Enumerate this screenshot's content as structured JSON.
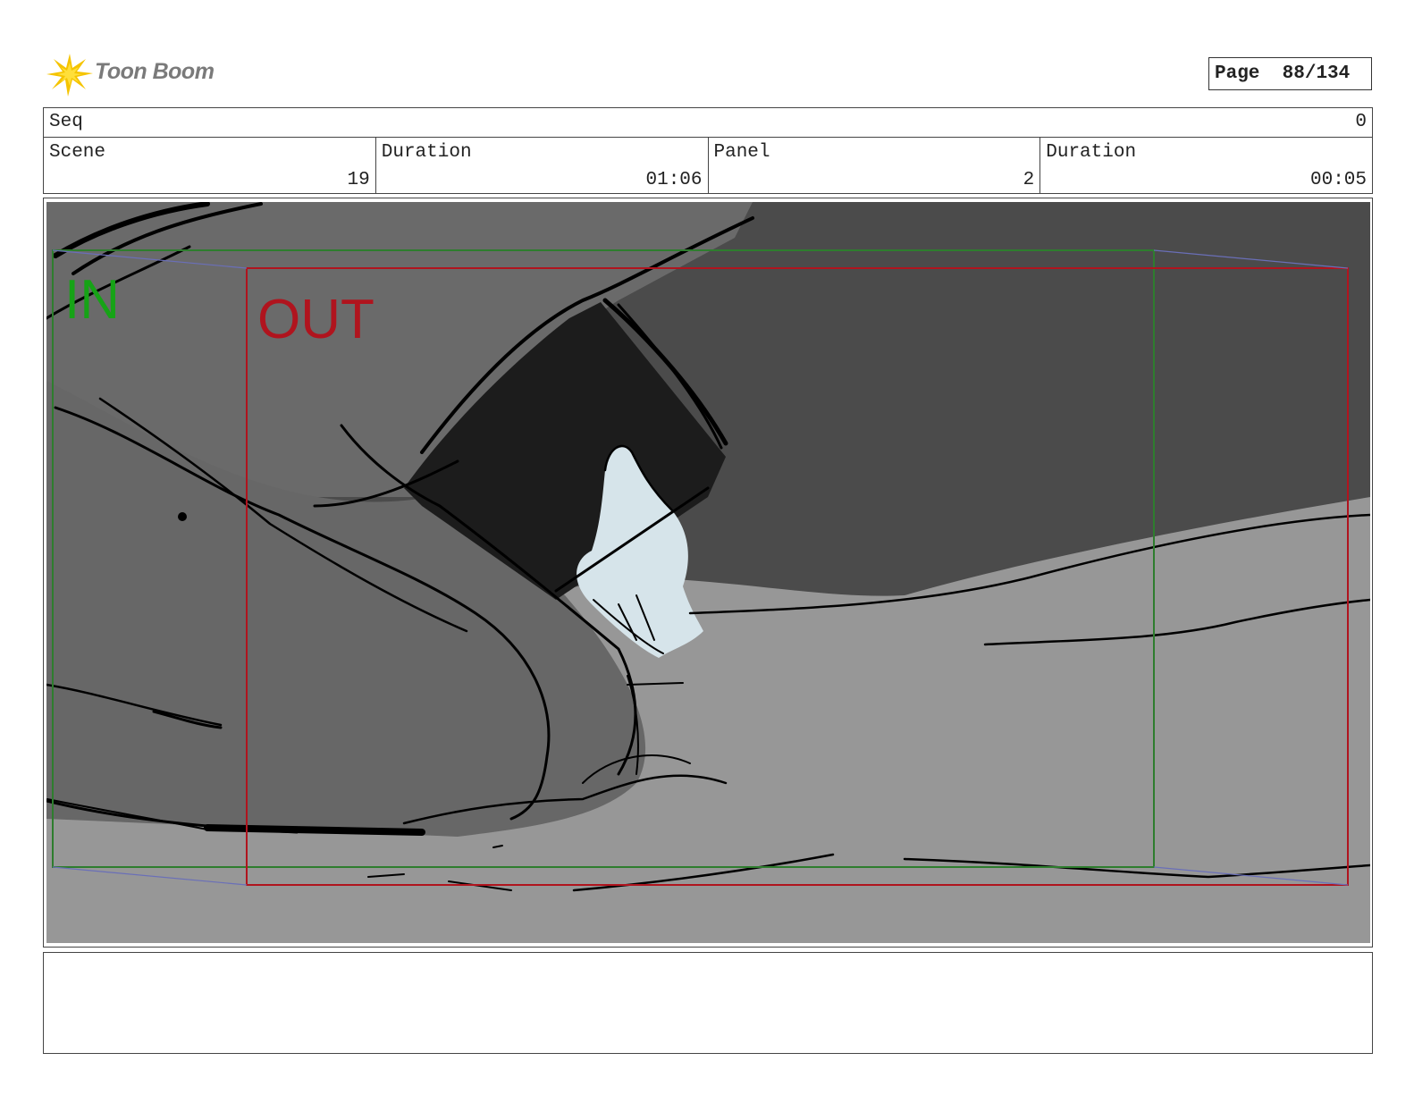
{
  "header": {
    "logo_text": "Toon Boom",
    "page_label": "Page",
    "page_value": "88/134"
  },
  "info": {
    "seq_label": "Seq",
    "seq_value": "0",
    "scene_label": "Scene",
    "scene_value": "19",
    "scene_duration_label": "Duration",
    "scene_duration_value": "01:06",
    "panel_label": "Panel",
    "panel_value": "2",
    "panel_duration_label": "Duration",
    "panel_duration_value": "00:05"
  },
  "frame": {
    "in_label": "IN",
    "out_label": "OUT",
    "colors": {
      "in_frame": "#2e7d2e",
      "in_text": "#16a316",
      "out_frame": "#b0141e",
      "out_text": "#b0141e",
      "camera_path": "#6a6fb8",
      "background_wall": "#4b4b4b",
      "floor": "#979797",
      "arm": "#666666",
      "sleeve": "#1c1c1c",
      "hand": "#d6e4ea"
    }
  },
  "notes": {
    "text": ""
  }
}
